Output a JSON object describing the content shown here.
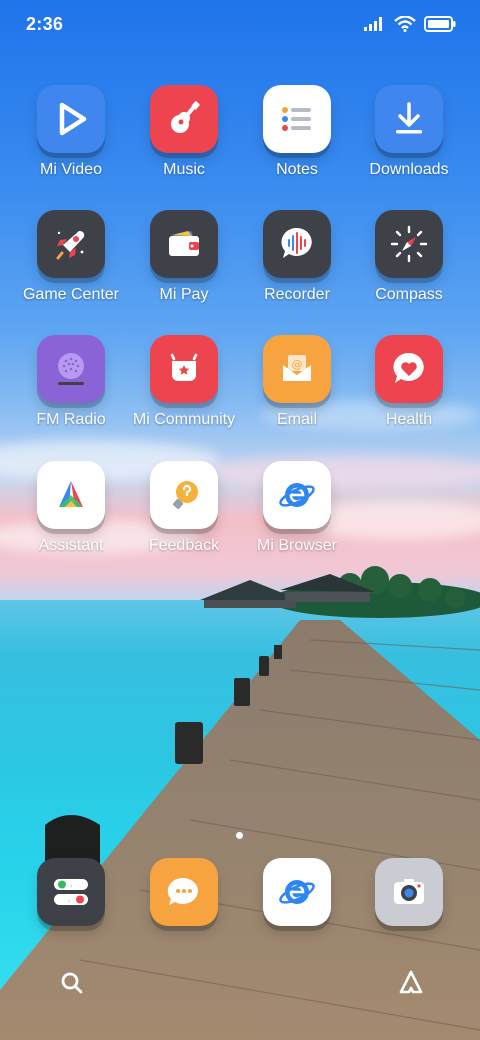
{
  "status_bar": {
    "time": "2:36",
    "icons": [
      "signal-icon",
      "wifi-icon",
      "battery-icon"
    ]
  },
  "apps": [
    {
      "id": "mi-video",
      "label": "Mi Video",
      "icon": "play-icon",
      "color": "#3f86ef"
    },
    {
      "id": "music",
      "label": "Music",
      "icon": "guitar-icon",
      "color": "#ee4450"
    },
    {
      "id": "notes",
      "label": "Notes",
      "icon": "list-icon",
      "color": "#ffffff"
    },
    {
      "id": "downloads",
      "label": "Downloads",
      "icon": "download-icon",
      "color": "#3f86ef"
    },
    {
      "id": "game-center",
      "label": "Game Center",
      "icon": "rocket-icon",
      "color": "#3e4147"
    },
    {
      "id": "mi-pay",
      "label": "Mi Pay",
      "icon": "wallet-icon",
      "color": "#3e4147"
    },
    {
      "id": "recorder",
      "label": "Recorder",
      "icon": "waveform-icon",
      "color": "#3e4147"
    },
    {
      "id": "compass",
      "label": "Compass",
      "icon": "compass-icon",
      "color": "#3e4147"
    },
    {
      "id": "fm-radio",
      "label": "FM Radio",
      "icon": "radio-icon",
      "color": "#8a63d6"
    },
    {
      "id": "mi-community",
      "label": "Mi Community",
      "icon": "community-icon",
      "color": "#ee4450"
    },
    {
      "id": "email",
      "label": "Email",
      "icon": "envelope-icon",
      "color": "#f6a340"
    },
    {
      "id": "health",
      "label": "Health",
      "icon": "heart-icon",
      "color": "#ee4450"
    },
    {
      "id": "assistant",
      "label": "Assistant",
      "icon": "assistant-icon",
      "color": "#ffffff"
    },
    {
      "id": "feedback",
      "label": "Feedback",
      "icon": "lightbulb-icon",
      "color": "#ffffff"
    },
    {
      "id": "mi-browser",
      "label": "Mi Browser",
      "icon": "browser-icon",
      "color": "#ffffff"
    }
  ],
  "dock": [
    {
      "id": "phone",
      "icon": "phone-icon",
      "color": "#3e4147"
    },
    {
      "id": "messages",
      "icon": "message-icon",
      "color": "#f6a340"
    },
    {
      "id": "browser",
      "icon": "browser-icon",
      "color": "#ffffff"
    },
    {
      "id": "camera",
      "icon": "camera-icon",
      "color": "#c9ccd3"
    }
  ],
  "bottom_nav": {
    "left": "search-icon",
    "right": "assistant-outline-icon"
  }
}
